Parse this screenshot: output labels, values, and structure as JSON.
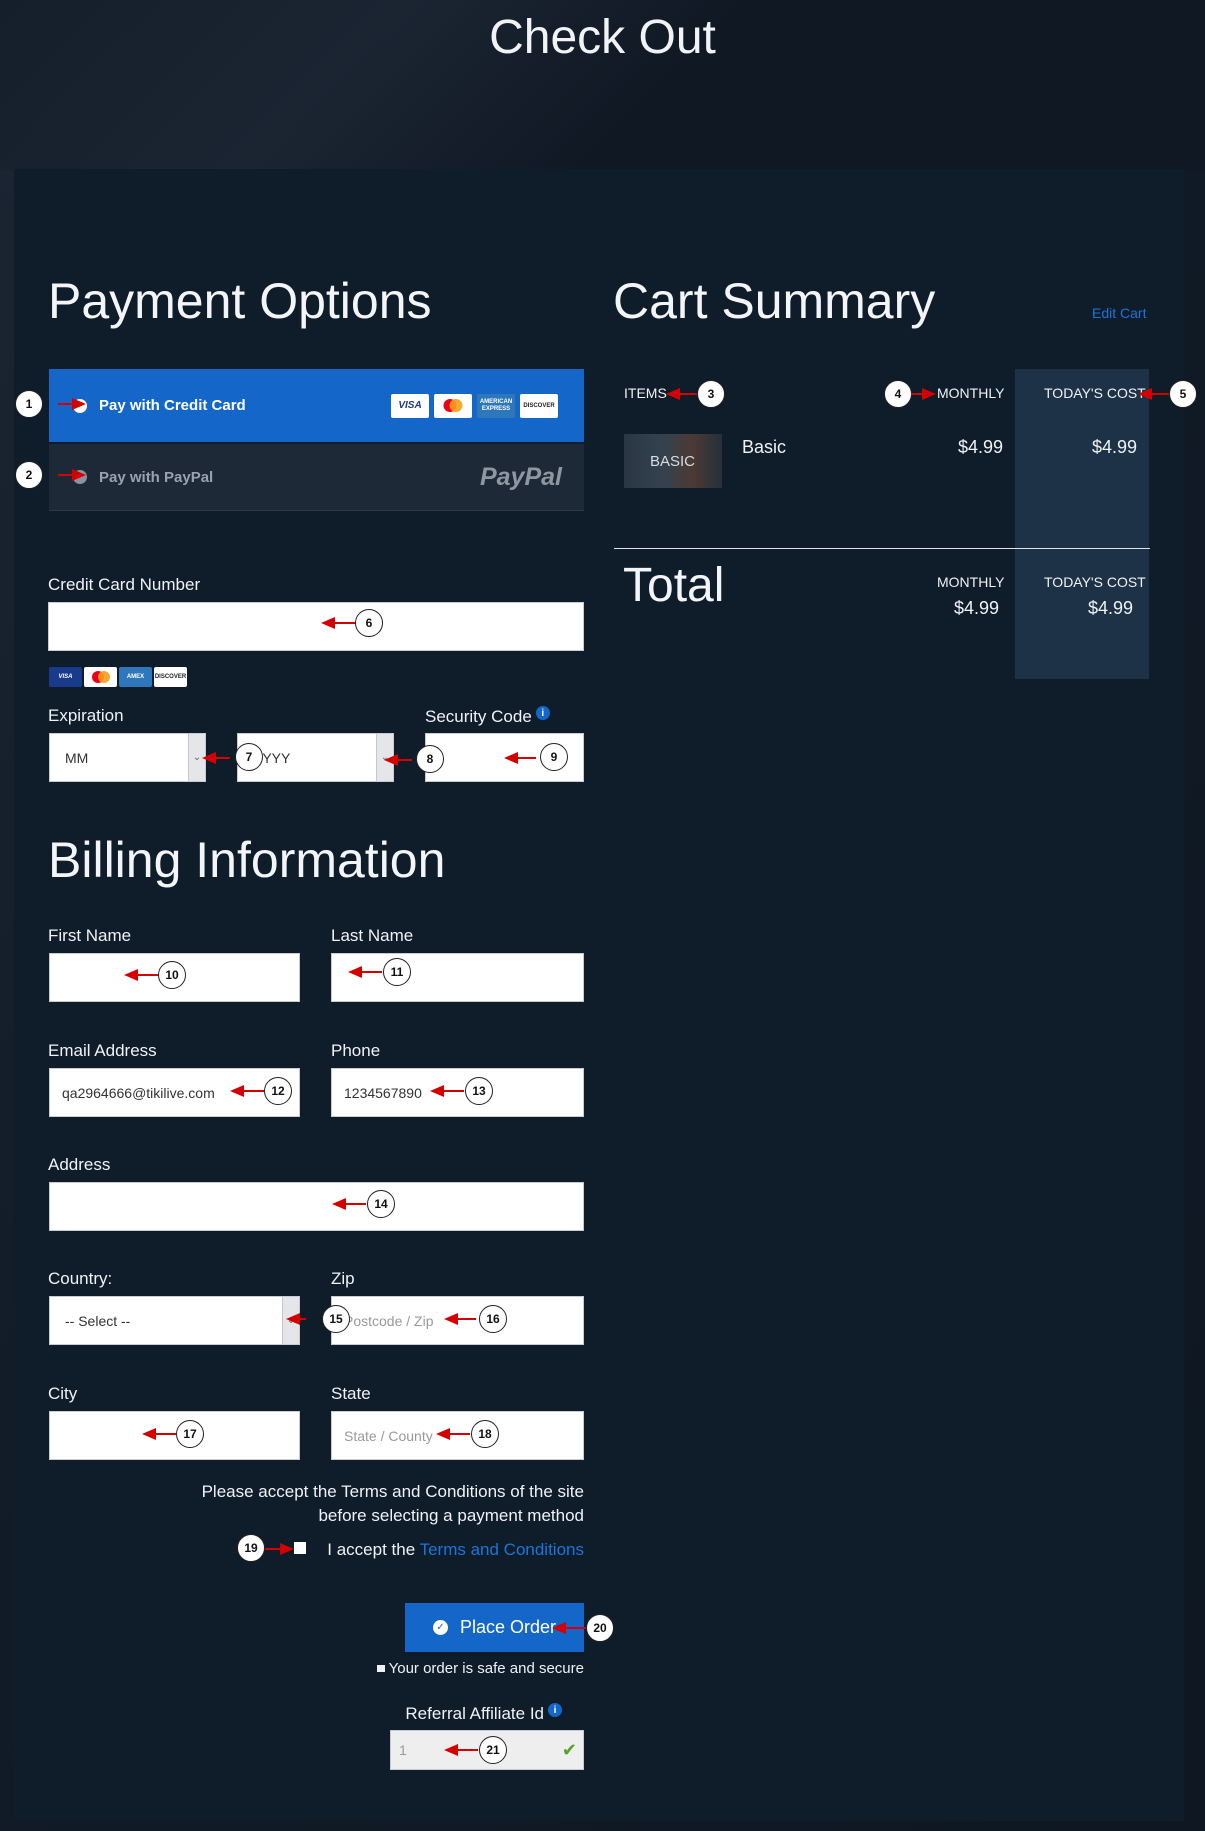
{
  "page": {
    "title": "Check Out"
  },
  "payment": {
    "heading": "Payment Options",
    "credit_card_label": "Pay with Credit Card",
    "paypal_label": "Pay with PayPal",
    "paypal_logo": "PayPal",
    "cards": [
      "VISA",
      "MasterCard",
      "AMERICAN EXPRESS",
      "DISCOVER"
    ],
    "cc_number_label": "Credit Card Number",
    "expiration_label": "Expiration",
    "month_value": "MM",
    "year_value": "YYYY",
    "security_label": "Security Code"
  },
  "cart": {
    "heading": "Cart Summary",
    "edit_link": "Edit Cart",
    "col_items": "ITEMS",
    "col_monthly": "MONTHLY",
    "col_today": "TODAY'S COST",
    "item_thumb": "BASIC",
    "item_name": "Basic",
    "item_monthly": "$4.99",
    "item_today": "$4.99",
    "total_label": "Total",
    "total_monthly_label": "MONTHLY",
    "total_monthly": "$4.99",
    "total_today_label": "TODAY'S COST",
    "total_today": "$4.99"
  },
  "billing": {
    "heading": "Billing Information",
    "first_name_label": "First Name",
    "last_name_label": "Last Name",
    "email_label": "Email Address",
    "email_value": "qa2964666@tikilive.com",
    "phone_label": "Phone",
    "phone_value": "1234567890",
    "address_label": "Address",
    "country_label": "Country:",
    "country_value": "-- Select --",
    "zip_label": "Zip",
    "zip_placeholder": "Postcode / Zip",
    "city_label": "City",
    "state_label": "State",
    "state_placeholder": "State / County"
  },
  "terms": {
    "line1": "Please accept the Terms and Conditions of the site",
    "line2": "before selecting a payment method",
    "accept_prefix": "I accept the",
    "link": "Terms and Conditions"
  },
  "order": {
    "button": "Place Order",
    "secure": "Your order is safe and secure",
    "referral_label": "Referral Affiliate Id",
    "referral_value": "1"
  },
  "callouts": [
    "1",
    "2",
    "3",
    "4",
    "5",
    "6",
    "7",
    "8",
    "9",
    "10",
    "11",
    "12",
    "13",
    "14",
    "15",
    "16",
    "17",
    "18",
    "19",
    "20",
    "21"
  ],
  "colors": {
    "accent": "#1467c9",
    "link": "#1b75d9",
    "annotation": "#d40000",
    "panel": "#0f1c2a"
  }
}
